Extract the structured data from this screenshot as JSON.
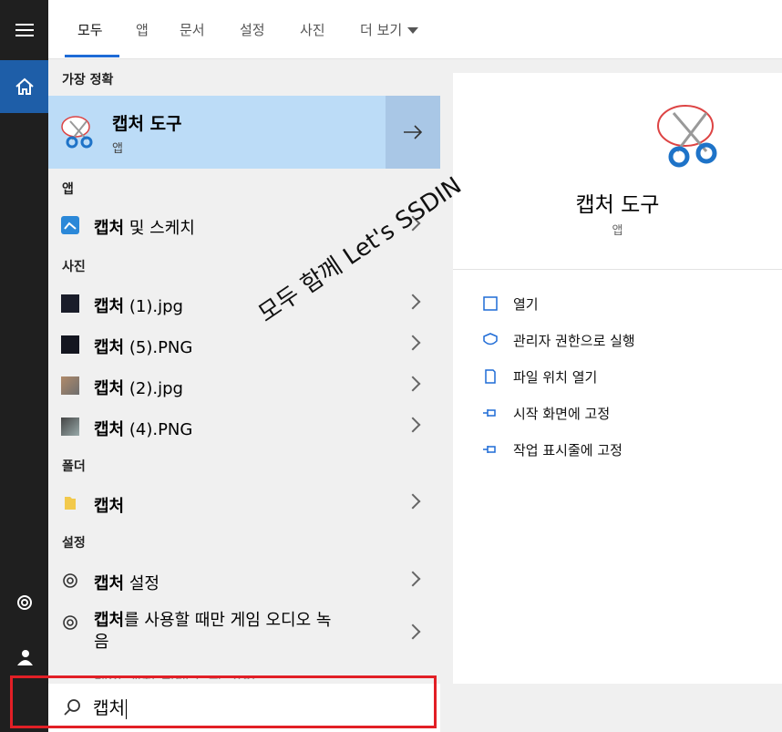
{
  "tabs": [
    "모두",
    "앱",
    "문서",
    "설정",
    "사진",
    "더 보기"
  ],
  "sections": {
    "best_match": "가장 정확",
    "apps": "앱",
    "photos": "사진",
    "folders": "폴더",
    "settings": "설정"
  },
  "best_match": {
    "name": "캡처 도구",
    "type": "앱"
  },
  "apps": [
    {
      "bold": "캡처",
      "rest": " 및 스케치",
      "icon": "snip-sketch-icon"
    }
  ],
  "photos": [
    {
      "bold": "캡처",
      "rest": " (1).jpg",
      "icon": "image-thumbnail-icon"
    },
    {
      "bold": "캡처",
      "rest": " (5).PNG",
      "icon": "image-thumbnail-icon"
    },
    {
      "bold": "캡처",
      "rest": " (2).jpg",
      "icon": "image-thumbnail-icon"
    },
    {
      "bold": "캡처",
      "rest": " (4).PNG",
      "icon": "image-thumbnail-icon"
    }
  ],
  "folders": [
    {
      "bold": "캡처",
      "rest": "",
      "icon": "folder-icon"
    }
  ],
  "settings": [
    {
      "bold": "캡처",
      "rest": " 설정",
      "icon": "gear-icon"
    },
    {
      "bold": "캡처",
      "rest": "를 사용할 때만 게임 오디오 녹",
      "rest2": "음",
      "icon": "gear-icon"
    }
  ],
  "partial_row": "게임 캡처 최대 녹화 길이",
  "preview": {
    "name": "캡처 도구",
    "type": "앱",
    "actions": [
      "열기",
      "관리자 권한으로 실행",
      "파일 위치 열기",
      "시작 화면에 고정",
      "작업 표시줄에 고정"
    ]
  },
  "search": {
    "value": "캡처"
  },
  "watermark": "모두 함께 Let's SSDIN",
  "colors": {
    "accent": "#1e6bd6",
    "highlight": "#bcdcf7",
    "rail": "#1f1f1f",
    "outline": "#e21f26"
  }
}
